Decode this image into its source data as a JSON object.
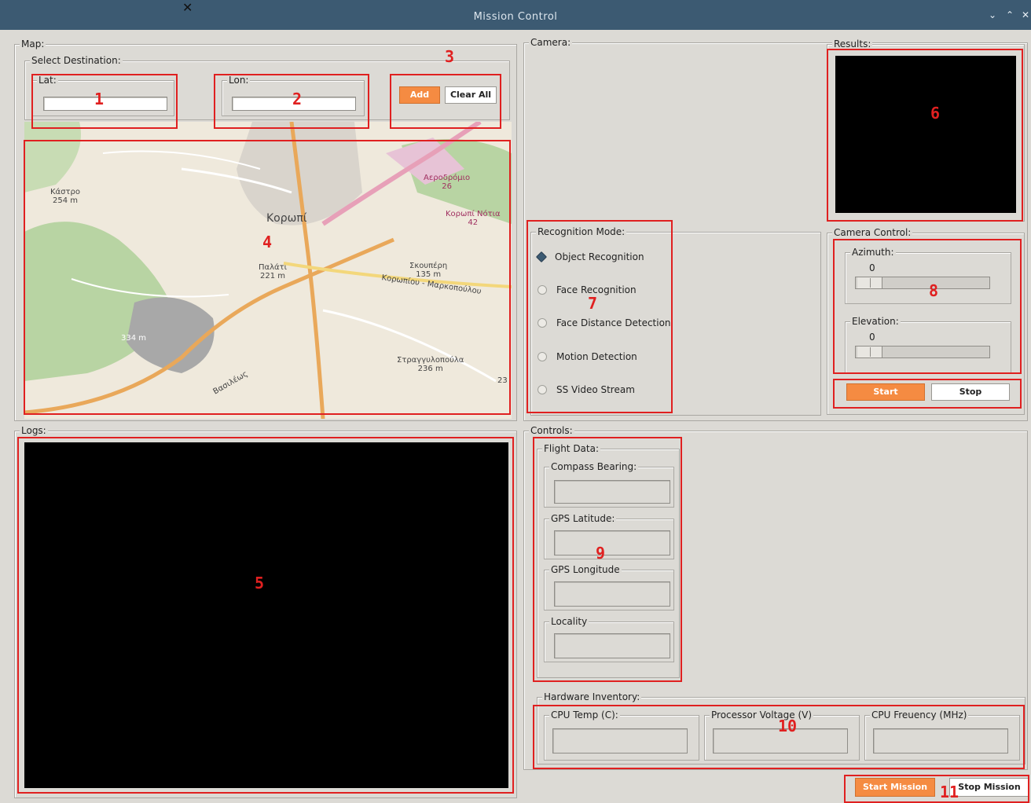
{
  "window": {
    "title": "Mission Control",
    "controls": {
      "minimize": "⌄",
      "maximize": "⌃",
      "close": "✕"
    }
  },
  "map": {
    "label": "Map:",
    "select_destination": {
      "label": "Select Destination:",
      "lat": {
        "label": "Lat:",
        "value": ""
      },
      "lon": {
        "label": "Lon:",
        "value": ""
      },
      "add_label": "Add",
      "clear_label": "Clear All"
    },
    "places": [
      {
        "name": "Κάστρο",
        "sub": "254 m"
      },
      {
        "name": "Κορωπί",
        "sub": ""
      },
      {
        "name": "Παλάτι",
        "sub": "221 m"
      },
      {
        "name": "Σκουπέρη",
        "sub": "135 m"
      },
      {
        "name": "Στραγγυλοπούλα",
        "sub": "236 m"
      },
      {
        "name": "334 m",
        "sub": ""
      },
      {
        "name": "Αεροδρόμιο",
        "sub": "26"
      },
      {
        "name": "Κορωπί Νότια",
        "sub": "42"
      },
      {
        "name": "Βασιλέως",
        "sub": ""
      },
      {
        "name": "Κορωπίου - Μαρκοπούλου",
        "sub": ""
      },
      {
        "name": "23",
        "sub": ""
      }
    ]
  },
  "camera": {
    "label": "Camera:"
  },
  "results": {
    "label": "Results:"
  },
  "recognition": {
    "label": "Recognition Mode:",
    "options": [
      {
        "label": "Object Recognition",
        "selected": true
      },
      {
        "label": "Face Recognition",
        "selected": false
      },
      {
        "label": "Face Distance Detection",
        "selected": false
      },
      {
        "label": "Motion Detection",
        "selected": false
      },
      {
        "label": "SS Video Stream",
        "selected": false
      }
    ]
  },
  "camera_control": {
    "label": "Camera Control:",
    "azimuth": {
      "label": "Azimuth:",
      "value": "0"
    },
    "elevation": {
      "label": "Elevation:",
      "value": "0"
    },
    "start_label": "Start",
    "stop_label": "Stop"
  },
  "logs": {
    "label": "Logs:"
  },
  "controls": {
    "label": "Controls:",
    "flight_data": {
      "label": "Flight Data:",
      "fields": [
        {
          "label": "Compass Bearing:",
          "value": ""
        },
        {
          "label": "GPS Latitude:",
          "value": ""
        },
        {
          "label": "GPS Longitude",
          "value": ""
        },
        {
          "label": "Locality",
          "value": ""
        }
      ]
    },
    "hardware": {
      "label": "Hardware Inventory:",
      "fields": [
        {
          "label": "CPU Temp (C):",
          "value": ""
        },
        {
          "label": "Processor Voltage (V)",
          "value": ""
        },
        {
          "label": "CPU Freuency (MHz)",
          "value": ""
        }
      ]
    },
    "start_mission_label": "Start Mission",
    "stop_mission_label": "Stop Mission"
  },
  "annotations": [
    "1",
    "2",
    "3",
    "4",
    "5",
    "6",
    "7",
    "8",
    "9",
    "10",
    "11"
  ],
  "colors": {
    "accent": "#f58b42",
    "annotation": "#e02020",
    "titlebar": "#3c5a72"
  }
}
